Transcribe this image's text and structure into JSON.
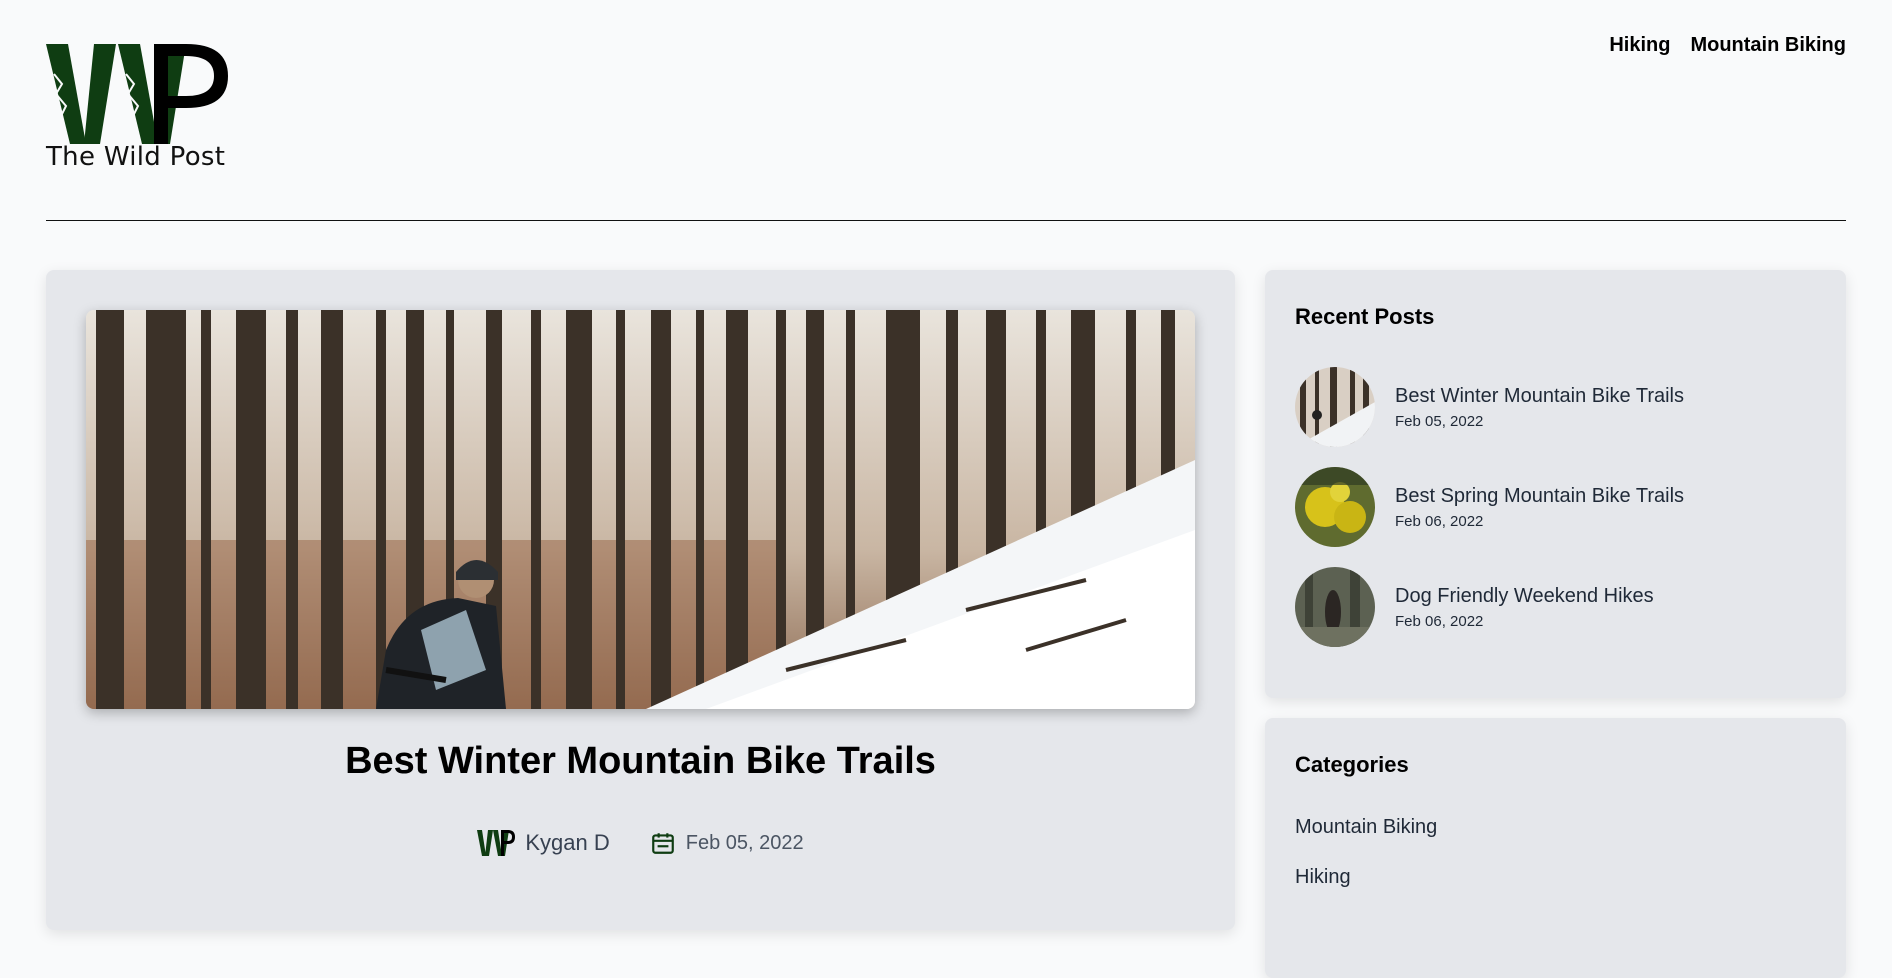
{
  "brand": {
    "logo_text": "The Wild Post",
    "accent_color": "#0f3d12"
  },
  "nav": {
    "items": [
      {
        "label": "Hiking"
      },
      {
        "label": "Mountain Biking"
      }
    ]
  },
  "post": {
    "title": "Best Winter Mountain Bike Trails",
    "author": "Kygan D",
    "date": "Feb 05, 2022",
    "image_icon": "forest-rider-photo"
  },
  "sidebar": {
    "recent_title": "Recent Posts",
    "recent": [
      {
        "title": "Best Winter Mountain Bike Trails",
        "date": "Feb 05, 2022"
      },
      {
        "title": "Best Spring Mountain Bike Trails",
        "date": "Feb 06, 2022"
      },
      {
        "title": "Dog Friendly Weekend Hikes",
        "date": "Feb 06, 2022"
      }
    ],
    "categories_title": "Categories",
    "categories": [
      {
        "label": "Mountain Biking"
      },
      {
        "label": "Hiking"
      }
    ]
  }
}
